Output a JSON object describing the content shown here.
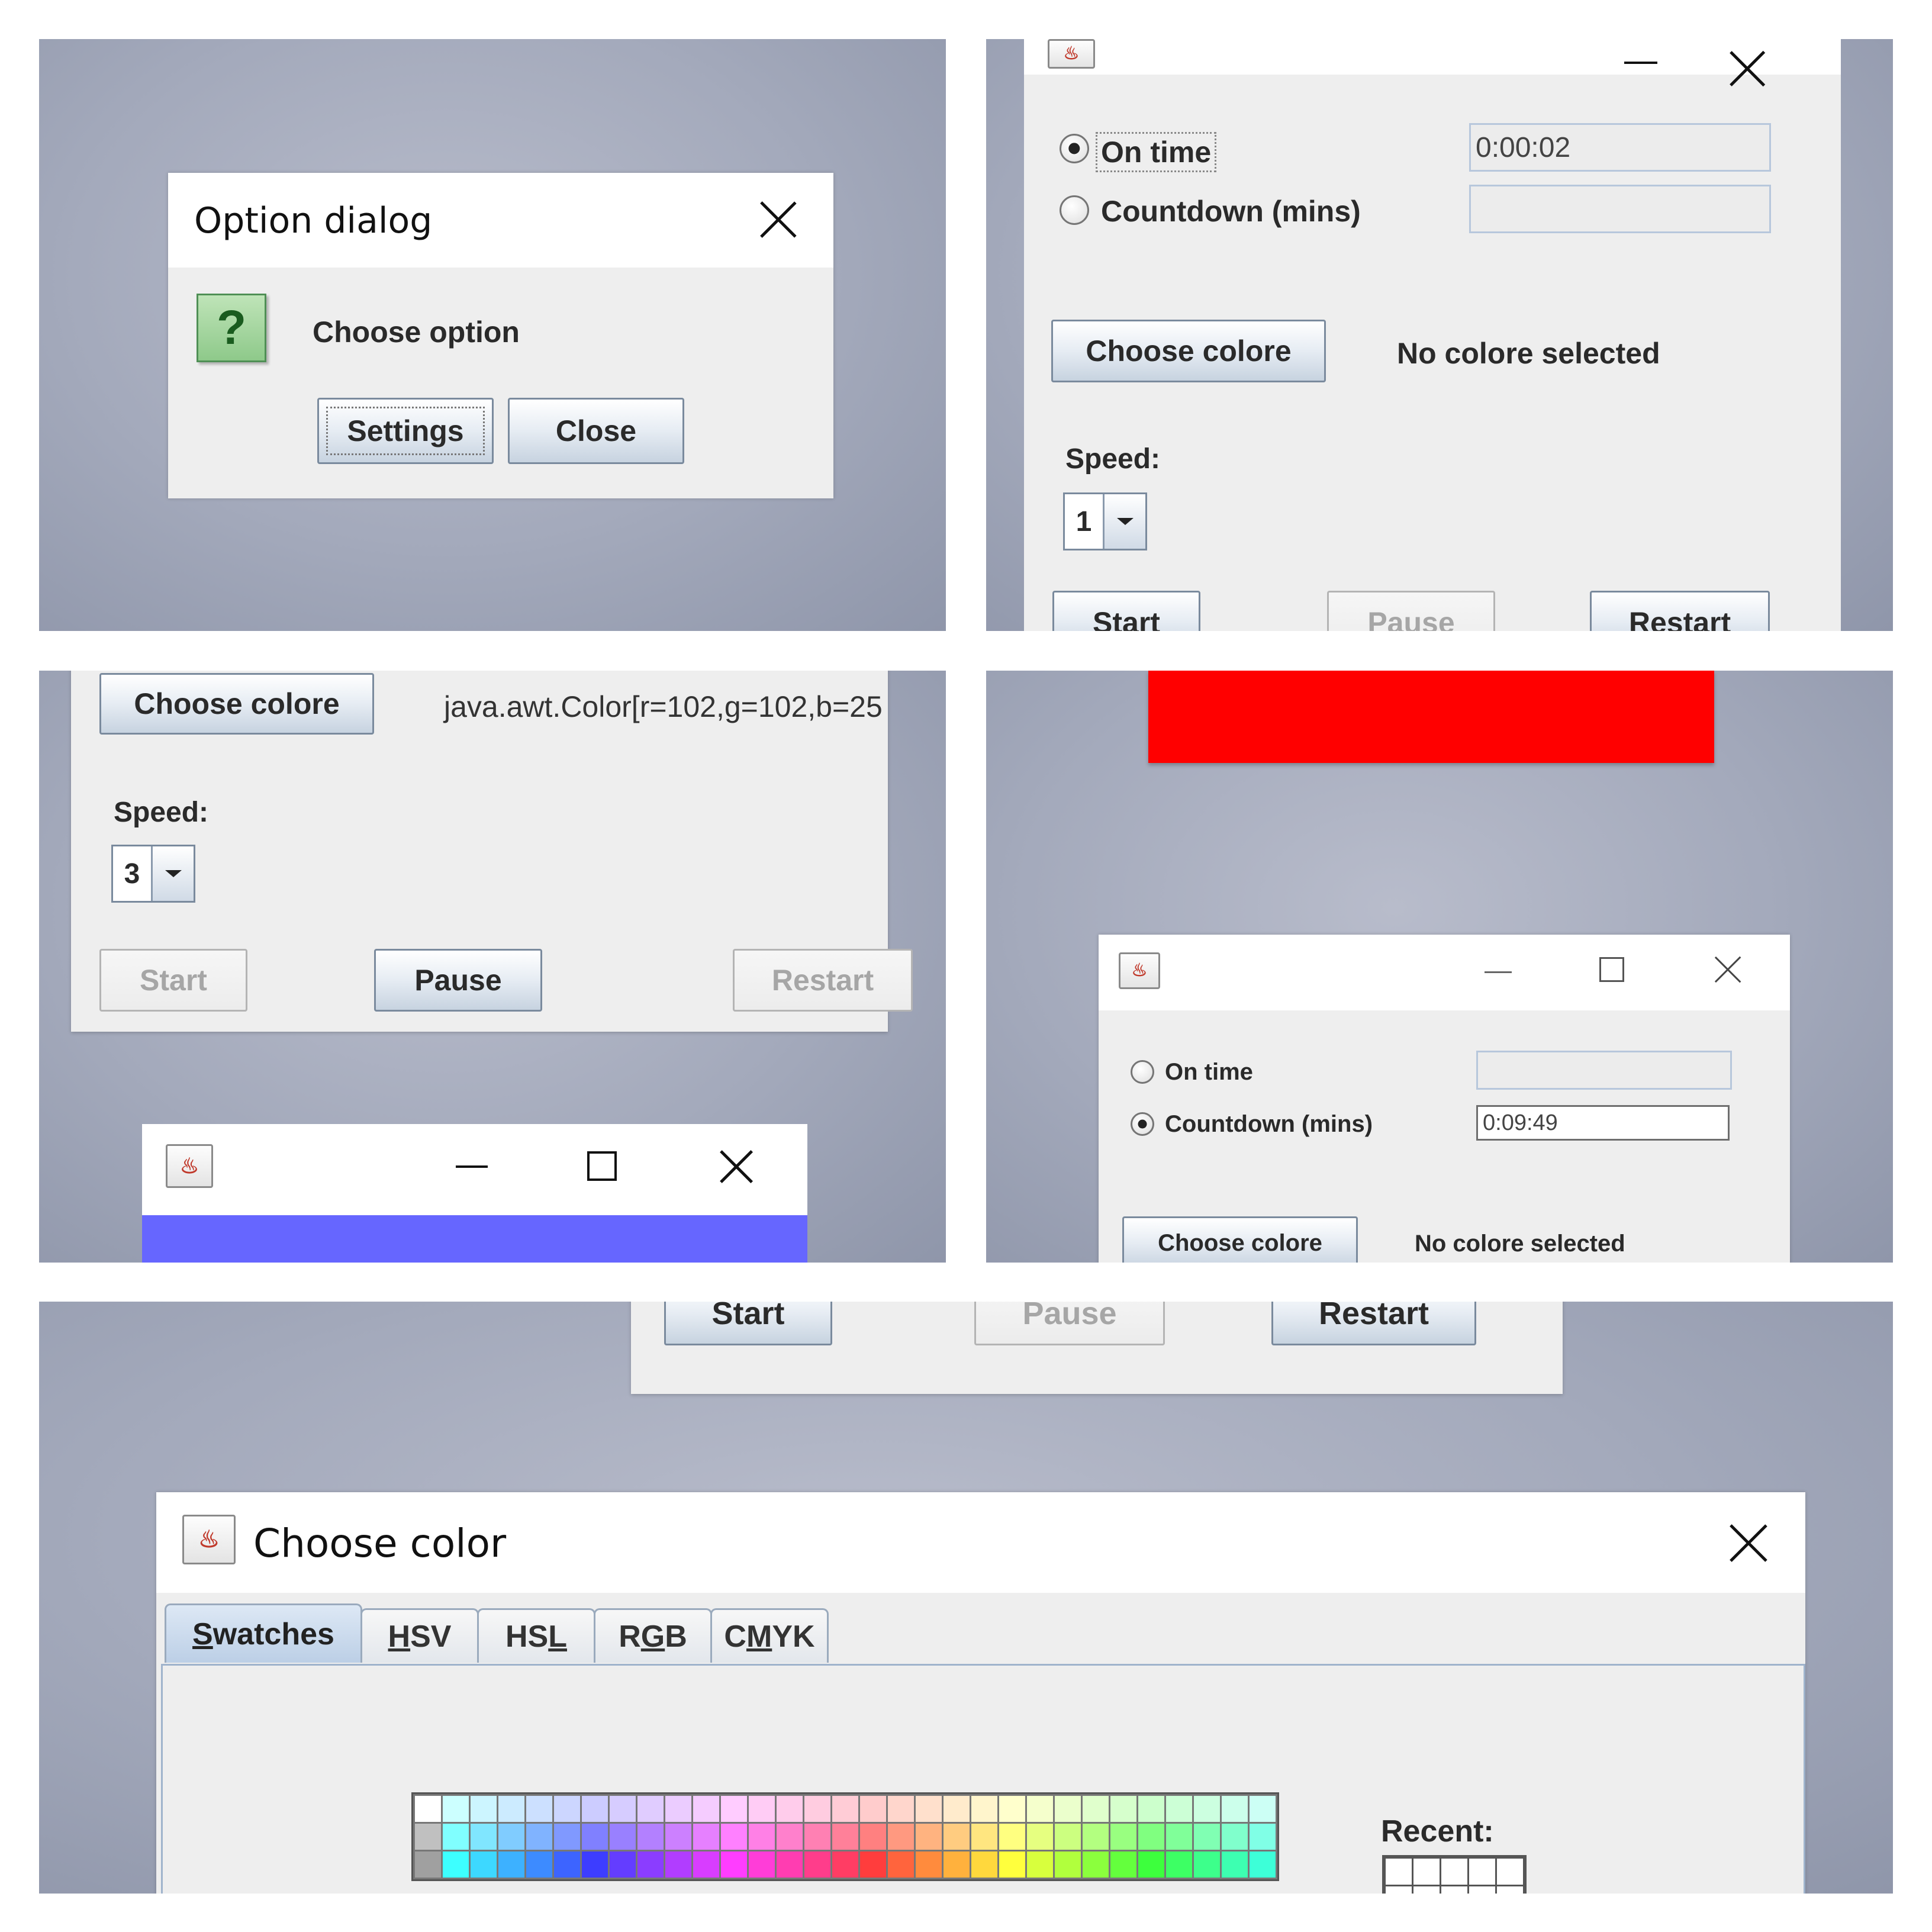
{
  "option_dialog": {
    "title": "Option dialog",
    "message": "Choose option",
    "icon": "question-icon",
    "icon_glyph": "?",
    "buttons": {
      "settings": "Settings",
      "close": "Close"
    }
  },
  "timer_window_1": {
    "on_time_label": "On time",
    "on_time_value": "0:00:02",
    "on_time_selected": true,
    "countdown_label": "Countdown (mins)",
    "countdown_value": "",
    "choose_color_label": "Choose colore",
    "color_status": "No colore selected",
    "speed_label": "Speed:",
    "speed_value": "1",
    "start_label": "Start",
    "pause_label": "Pause",
    "restart_label": "Restart"
  },
  "timer_window_2": {
    "choose_color_label": "Choose colore",
    "color_status": "java.awt.Color[r=102,g=102,b=25",
    "speed_label": "Speed:",
    "speed_value": "3",
    "start_label": "Start",
    "pause_label": "Pause",
    "restart_label": "Restart",
    "preview_color": "#6666ff"
  },
  "timer_window_3": {
    "preview_color": "#ff0000",
    "on_time_label": "On time",
    "on_time_value": "",
    "countdown_label": "Countdown (mins)",
    "countdown_value": "0:09:49",
    "countdown_selected": true,
    "choose_color_label": "Choose colore",
    "color_status": "No colore selected"
  },
  "color_chooser": {
    "partial_buttons": {
      "start": "Start",
      "pause": "Pause",
      "restart": "Restart"
    },
    "title": "Choose color",
    "tabs": [
      {
        "pre": "",
        "mn": "S",
        "post": "watches",
        "selected": true
      },
      {
        "pre": "",
        "mn": "H",
        "post": "SV",
        "selected": false
      },
      {
        "pre": "HS",
        "mn": "L",
        "post": "",
        "selected": false
      },
      {
        "pre": "R",
        "mn": "G",
        "post": "B",
        "selected": false
      },
      {
        "pre": "C",
        "mn": "M",
        "post": "YK",
        "selected": false
      }
    ],
    "recent_label": "Recent:"
  }
}
